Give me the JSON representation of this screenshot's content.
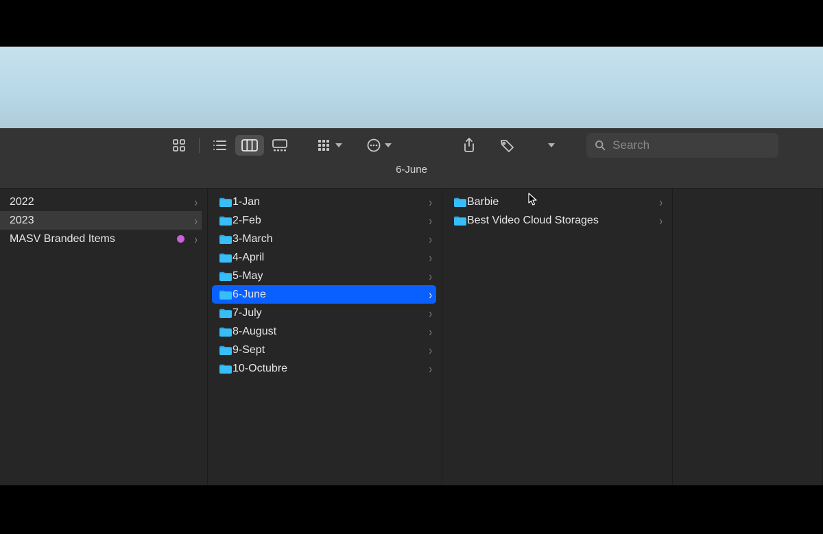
{
  "window": {
    "title": "6-June",
    "search_placeholder": "Search"
  },
  "columns": [
    {
      "items": [
        {
          "name": "2022",
          "tag": null,
          "has_chevron": true,
          "selected": false
        },
        {
          "name": "2023",
          "tag": null,
          "has_chevron": true,
          "selected": "gray"
        },
        {
          "name": "MASV Branded Items",
          "tag": "purple",
          "has_chevron": true,
          "selected": false
        }
      ]
    },
    {
      "items": [
        {
          "name": "1-Jan",
          "has_chevron": true,
          "selected": false
        },
        {
          "name": "2-Feb",
          "has_chevron": true,
          "selected": false
        },
        {
          "name": "3-March",
          "has_chevron": true,
          "selected": false
        },
        {
          "name": "4-April",
          "has_chevron": true,
          "selected": false
        },
        {
          "name": "5-May",
          "has_chevron": true,
          "selected": false
        },
        {
          "name": "6-June",
          "has_chevron": true,
          "selected": "blue"
        },
        {
          "name": "7-July",
          "has_chevron": true,
          "selected": false
        },
        {
          "name": "8-August",
          "has_chevron": true,
          "selected": false
        },
        {
          "name": "9-Sept",
          "has_chevron": true,
          "selected": false
        },
        {
          "name": "10-Octubre",
          "has_chevron": true,
          "selected": false
        }
      ]
    },
    {
      "items": [
        {
          "name": "Barbie",
          "has_chevron": true,
          "selected": false
        },
        {
          "name": "Best Video Cloud Storages",
          "has_chevron": true,
          "selected": false
        }
      ]
    },
    {
      "items": []
    }
  ]
}
